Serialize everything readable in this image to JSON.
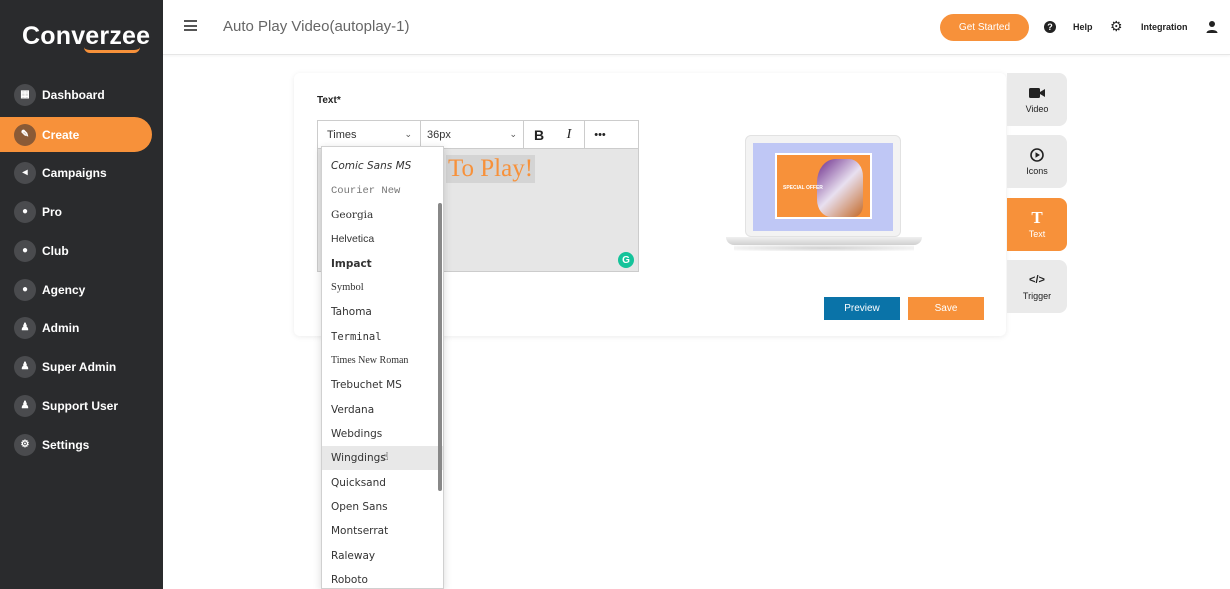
{
  "brand": {
    "logo": "Converzee",
    "accent": "#f7913a"
  },
  "sidebar": {
    "items": [
      {
        "label": "Dashboard",
        "icon": "dashboard-icon",
        "active": false
      },
      {
        "label": "Create",
        "icon": "create-icon",
        "active": true
      },
      {
        "label": "Campaigns",
        "icon": "campaigns-icon",
        "active": false
      },
      {
        "label": "Pro",
        "icon": "pro-icon",
        "active": false
      },
      {
        "label": "Club",
        "icon": "club-icon",
        "active": false
      },
      {
        "label": "Agency",
        "icon": "agency-icon",
        "active": false
      },
      {
        "label": "Admin",
        "icon": "admin-icon",
        "active": false
      },
      {
        "label": "Super Admin",
        "icon": "super-admin-icon",
        "active": false
      },
      {
        "label": "Support User",
        "icon": "support-user-icon",
        "active": false
      },
      {
        "label": "Settings",
        "icon": "settings-icon",
        "active": false
      }
    ]
  },
  "header": {
    "title": "Auto Play Video(autoplay-1)",
    "get_started": "Get Started",
    "help": "Help",
    "integration": "Integration"
  },
  "editor": {
    "field_label": "Text*",
    "font_value": "Times",
    "size_value": "36px",
    "bold": "B",
    "italic": "I",
    "more": "•••",
    "content": "To Play!"
  },
  "promo": {
    "text": "SPECIAL OFFER"
  },
  "actions": {
    "preview": "Preview",
    "save": "Save"
  },
  "right_tabs": [
    {
      "label": "Video",
      "icon": "video-camera-icon",
      "active": false
    },
    {
      "label": "Icons",
      "icon": "play-circle-icon",
      "active": false
    },
    {
      "label": "Text",
      "icon": "text-icon",
      "active": true
    },
    {
      "label": "Trigger",
      "icon": "code-icon",
      "active": false
    }
  ],
  "font_dropdown": {
    "options": [
      "Comic Sans MS",
      "Courier New",
      "Georgia",
      "Helvetica",
      "Impact",
      "Symbol",
      "Tahoma",
      "Terminal",
      "Times New Roman",
      "Trebuchet MS",
      "Verdana",
      "Webdings",
      "Wingdings",
      "Quicksand",
      "Open Sans",
      "Montserrat",
      "Raleway",
      "Roboto"
    ],
    "hovered": "Wingdings"
  }
}
